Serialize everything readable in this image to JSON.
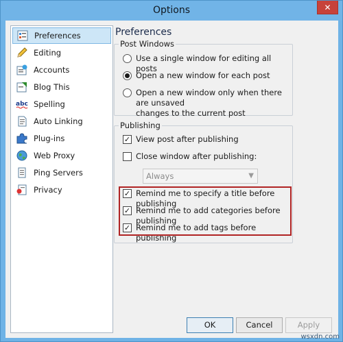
{
  "window": {
    "title": "Options",
    "close_glyph": "✕"
  },
  "sidebar": {
    "items": [
      {
        "label": "Preferences",
        "icon": "preferences-icon",
        "selected": true
      },
      {
        "label": "Editing",
        "icon": "pencil-icon"
      },
      {
        "label": "Accounts",
        "icon": "accounts-icon"
      },
      {
        "label": "Blog This",
        "icon": "blog-this-icon"
      },
      {
        "label": "Spelling",
        "icon": "spelling-abc-icon"
      },
      {
        "label": "Auto Linking",
        "icon": "document-link-icon"
      },
      {
        "label": "Plug-ins",
        "icon": "puzzle-icon"
      },
      {
        "label": "Web Proxy",
        "icon": "globe-icon"
      },
      {
        "label": "Ping Servers",
        "icon": "ping-servers-icon"
      },
      {
        "label": "Privacy",
        "icon": "privacy-icon"
      }
    ]
  },
  "main": {
    "title": "Preferences",
    "post_windows": {
      "title": "Post Windows",
      "options": [
        {
          "label": "Use a single window for editing all posts",
          "checked": false
        },
        {
          "label": "Open a new window for each post",
          "checked": true
        },
        {
          "label": "Open a new window only when there are unsaved",
          "label2": "changes to the current post",
          "checked": false
        }
      ]
    },
    "publishing": {
      "title": "Publishing",
      "view_post": {
        "label": "View post after publishing",
        "checked": true
      },
      "close_window": {
        "label": "Close window after publishing:",
        "checked": false
      },
      "close_select": {
        "value": "Always"
      },
      "remind_title": {
        "label": "Remind me to specify a title before publishing",
        "checked": true
      },
      "remind_categories": {
        "label": "Remind me to add categories before publishing",
        "checked": true
      },
      "remind_tags": {
        "label": "Remind me to add tags before publishing",
        "checked": true
      },
      "highlight_color": "#b02323"
    }
  },
  "buttons": {
    "ok": "OK",
    "cancel": "Cancel",
    "apply": "Apply"
  },
  "watermark": "wsxdn.com",
  "colors": {
    "titlebar": "#71b4e7",
    "selection": "#cde6f7",
    "close": "#c7423a"
  }
}
